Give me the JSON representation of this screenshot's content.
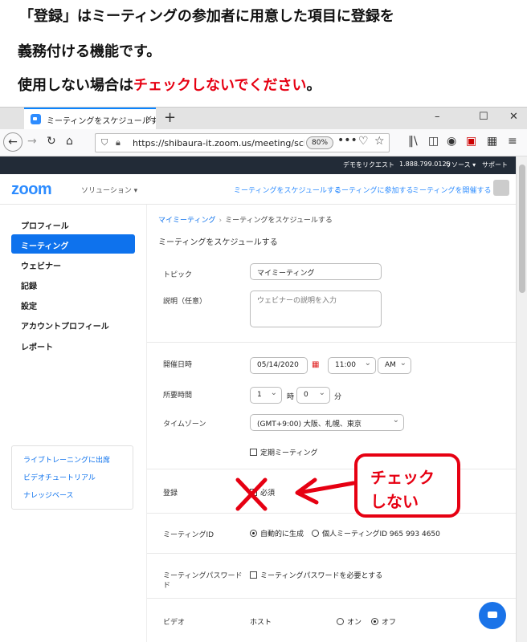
{
  "instruction": {
    "line1": "「登録」はミーティングの参加者に用意した項目に登録を",
    "line2": "義務付ける機能です。",
    "line3_prefix": "使用しない場合は",
    "line3_red": "チェックしないでください",
    "line3_suffix": "。"
  },
  "browser": {
    "tab_title": "ミーティングをスケジュールする - Zoom",
    "tab_close": "×",
    "new_tab": "+",
    "url": "https://shibaura-it.zoom.us/meeting/schedule",
    "zoom_level": "80%",
    "minimize": "–",
    "maximize": "☐",
    "close": "✕"
  },
  "zoom": {
    "topstrip": {
      "demo": "デモをリクエスト",
      "phone": "1.888.799.0125",
      "resources": "リソース ▾",
      "support": "サポート"
    },
    "logo": "zoom",
    "solutions": "ソリューション ▾",
    "header_links": {
      "schedule": "ミーティングをスケジュールする",
      "join": "ミーティングに参加する",
      "host": "ミーティングを開催する ▾"
    },
    "sidebar": {
      "items": [
        {
          "label": "プロフィール"
        },
        {
          "label": "ミーティング",
          "active": true
        },
        {
          "label": "ウェビナー"
        },
        {
          "label": "記録"
        },
        {
          "label": "設定"
        },
        {
          "label": "アカウントプロフィール"
        },
        {
          "label": "レポート"
        }
      ],
      "links": [
        "ライブトレーニングに出席",
        "ビデオチュートリアル",
        "ナレッジベース"
      ]
    },
    "breadcrumb": {
      "parent": "マイミーティング",
      "sep": "›",
      "current": "ミーティングをスケジュールする"
    },
    "page_title": "ミーティングをスケジュールする",
    "form": {
      "topic_label": "トピック",
      "topic_value": "マイミーティング",
      "desc_label": "説明（任意）",
      "desc_placeholder": "ウェビナーの説明を入力",
      "when_label": "開催日時",
      "date": "05/14/2020",
      "time": "11:00",
      "ampm": "AM",
      "duration_label": "所要時間",
      "hours": "1",
      "hours_unit": "時",
      "minutes": "0",
      "minutes_unit": "分",
      "timezone_label": "タイムゾーン",
      "timezone": "(GMT+9:00) 大阪、札幌、東京",
      "recurring": "定期ミーティング",
      "registration_label": "登録",
      "registration_required": "必須",
      "meetingid_label": "ミーティングID",
      "meetingid_auto": "自動的に生成",
      "meetingid_personal": "個人ミーティングID 965 993 4650",
      "password_label": "ミーティングパスワード",
      "password_label2": "ド",
      "password_option": "ミーティングパスワードを必要とする",
      "video_label": "ビデオ",
      "host_label": "ホスト",
      "video_on": "オン",
      "video_off": "オフ"
    }
  },
  "annotation": {
    "callout_line1": "チェック",
    "callout_line2": "しない",
    "color": "#e60012"
  }
}
